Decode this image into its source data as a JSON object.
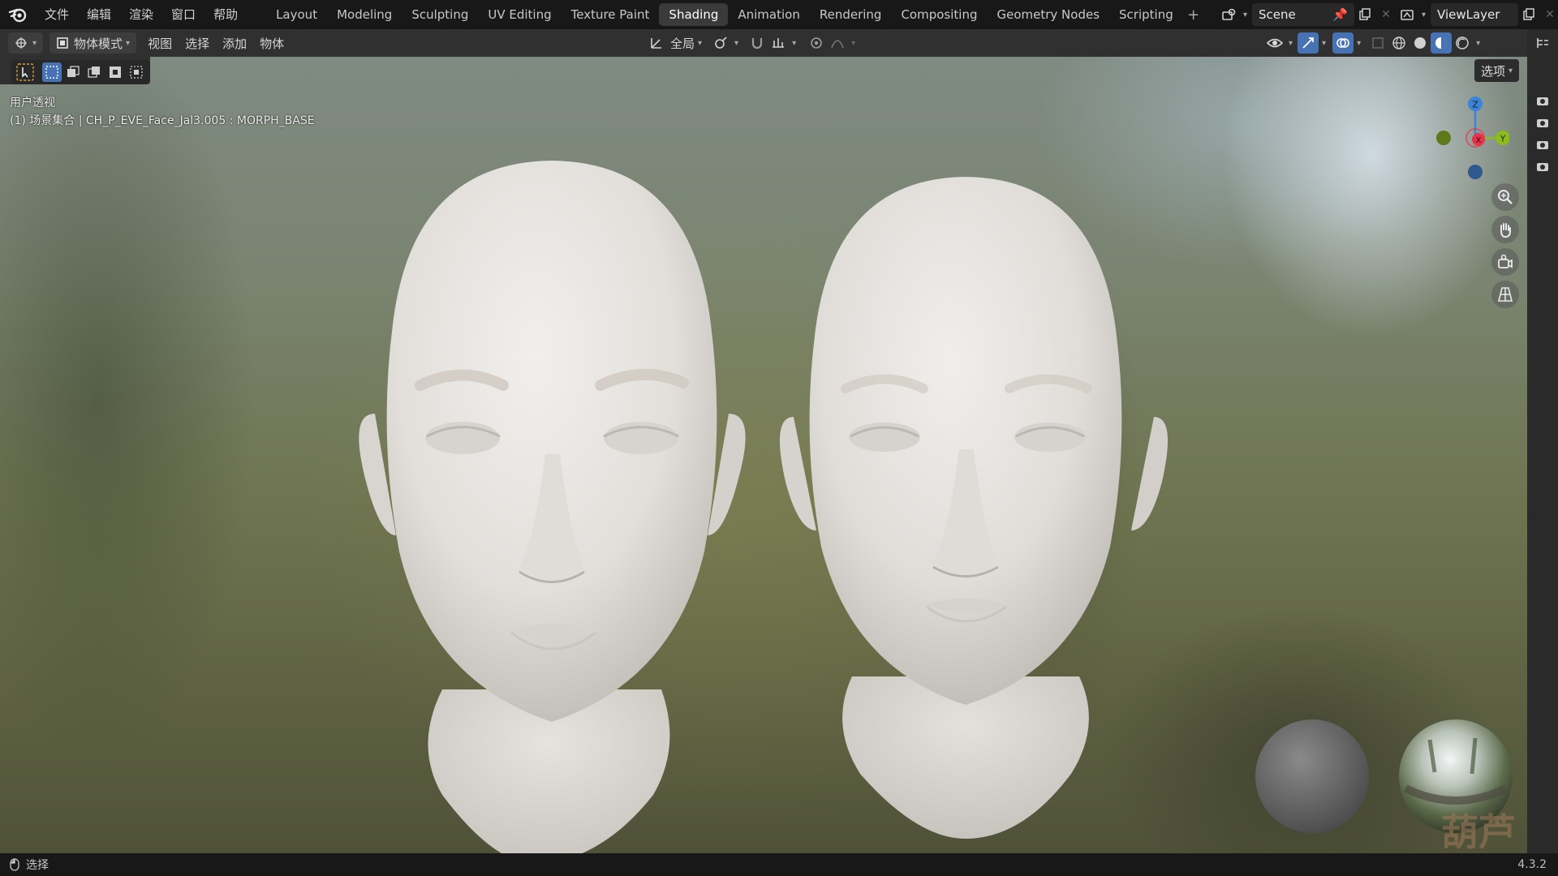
{
  "menu": {
    "items": [
      "文件",
      "编辑",
      "渲染",
      "窗口",
      "帮助"
    ]
  },
  "workspaces": {
    "tabs": [
      "Layout",
      "Modeling",
      "Sculpting",
      "UV Editing",
      "Texture Paint",
      "Shading",
      "Animation",
      "Rendering",
      "Compositing",
      "Geometry Nodes",
      "Scripting"
    ],
    "active": "Shading",
    "add_label": "+"
  },
  "scene": {
    "name": "Scene"
  },
  "view_layer": {
    "name": "ViewLayer"
  },
  "header": {
    "mode_label": "物体模式",
    "menus": [
      "视图",
      "选择",
      "添加",
      "物体"
    ],
    "transform_orientation": "全局"
  },
  "viewport": {
    "options_label": "选项",
    "view_name": "用户透视",
    "object_info": "(1) 场景集合 | CH_P_EVE_Face_Jal3.005 : MORPH_BASE",
    "gizmo": {
      "z": "Z",
      "y": "Y",
      "x": "X"
    },
    "watermark": "葫芦"
  },
  "status": {
    "left_label": "选择",
    "version": "4.3.2"
  },
  "colors": {
    "accent_blue": "#4772b3",
    "axis_x": "#e8334a",
    "axis_y": "#8cbc1c",
    "axis_z": "#3c84d8"
  }
}
